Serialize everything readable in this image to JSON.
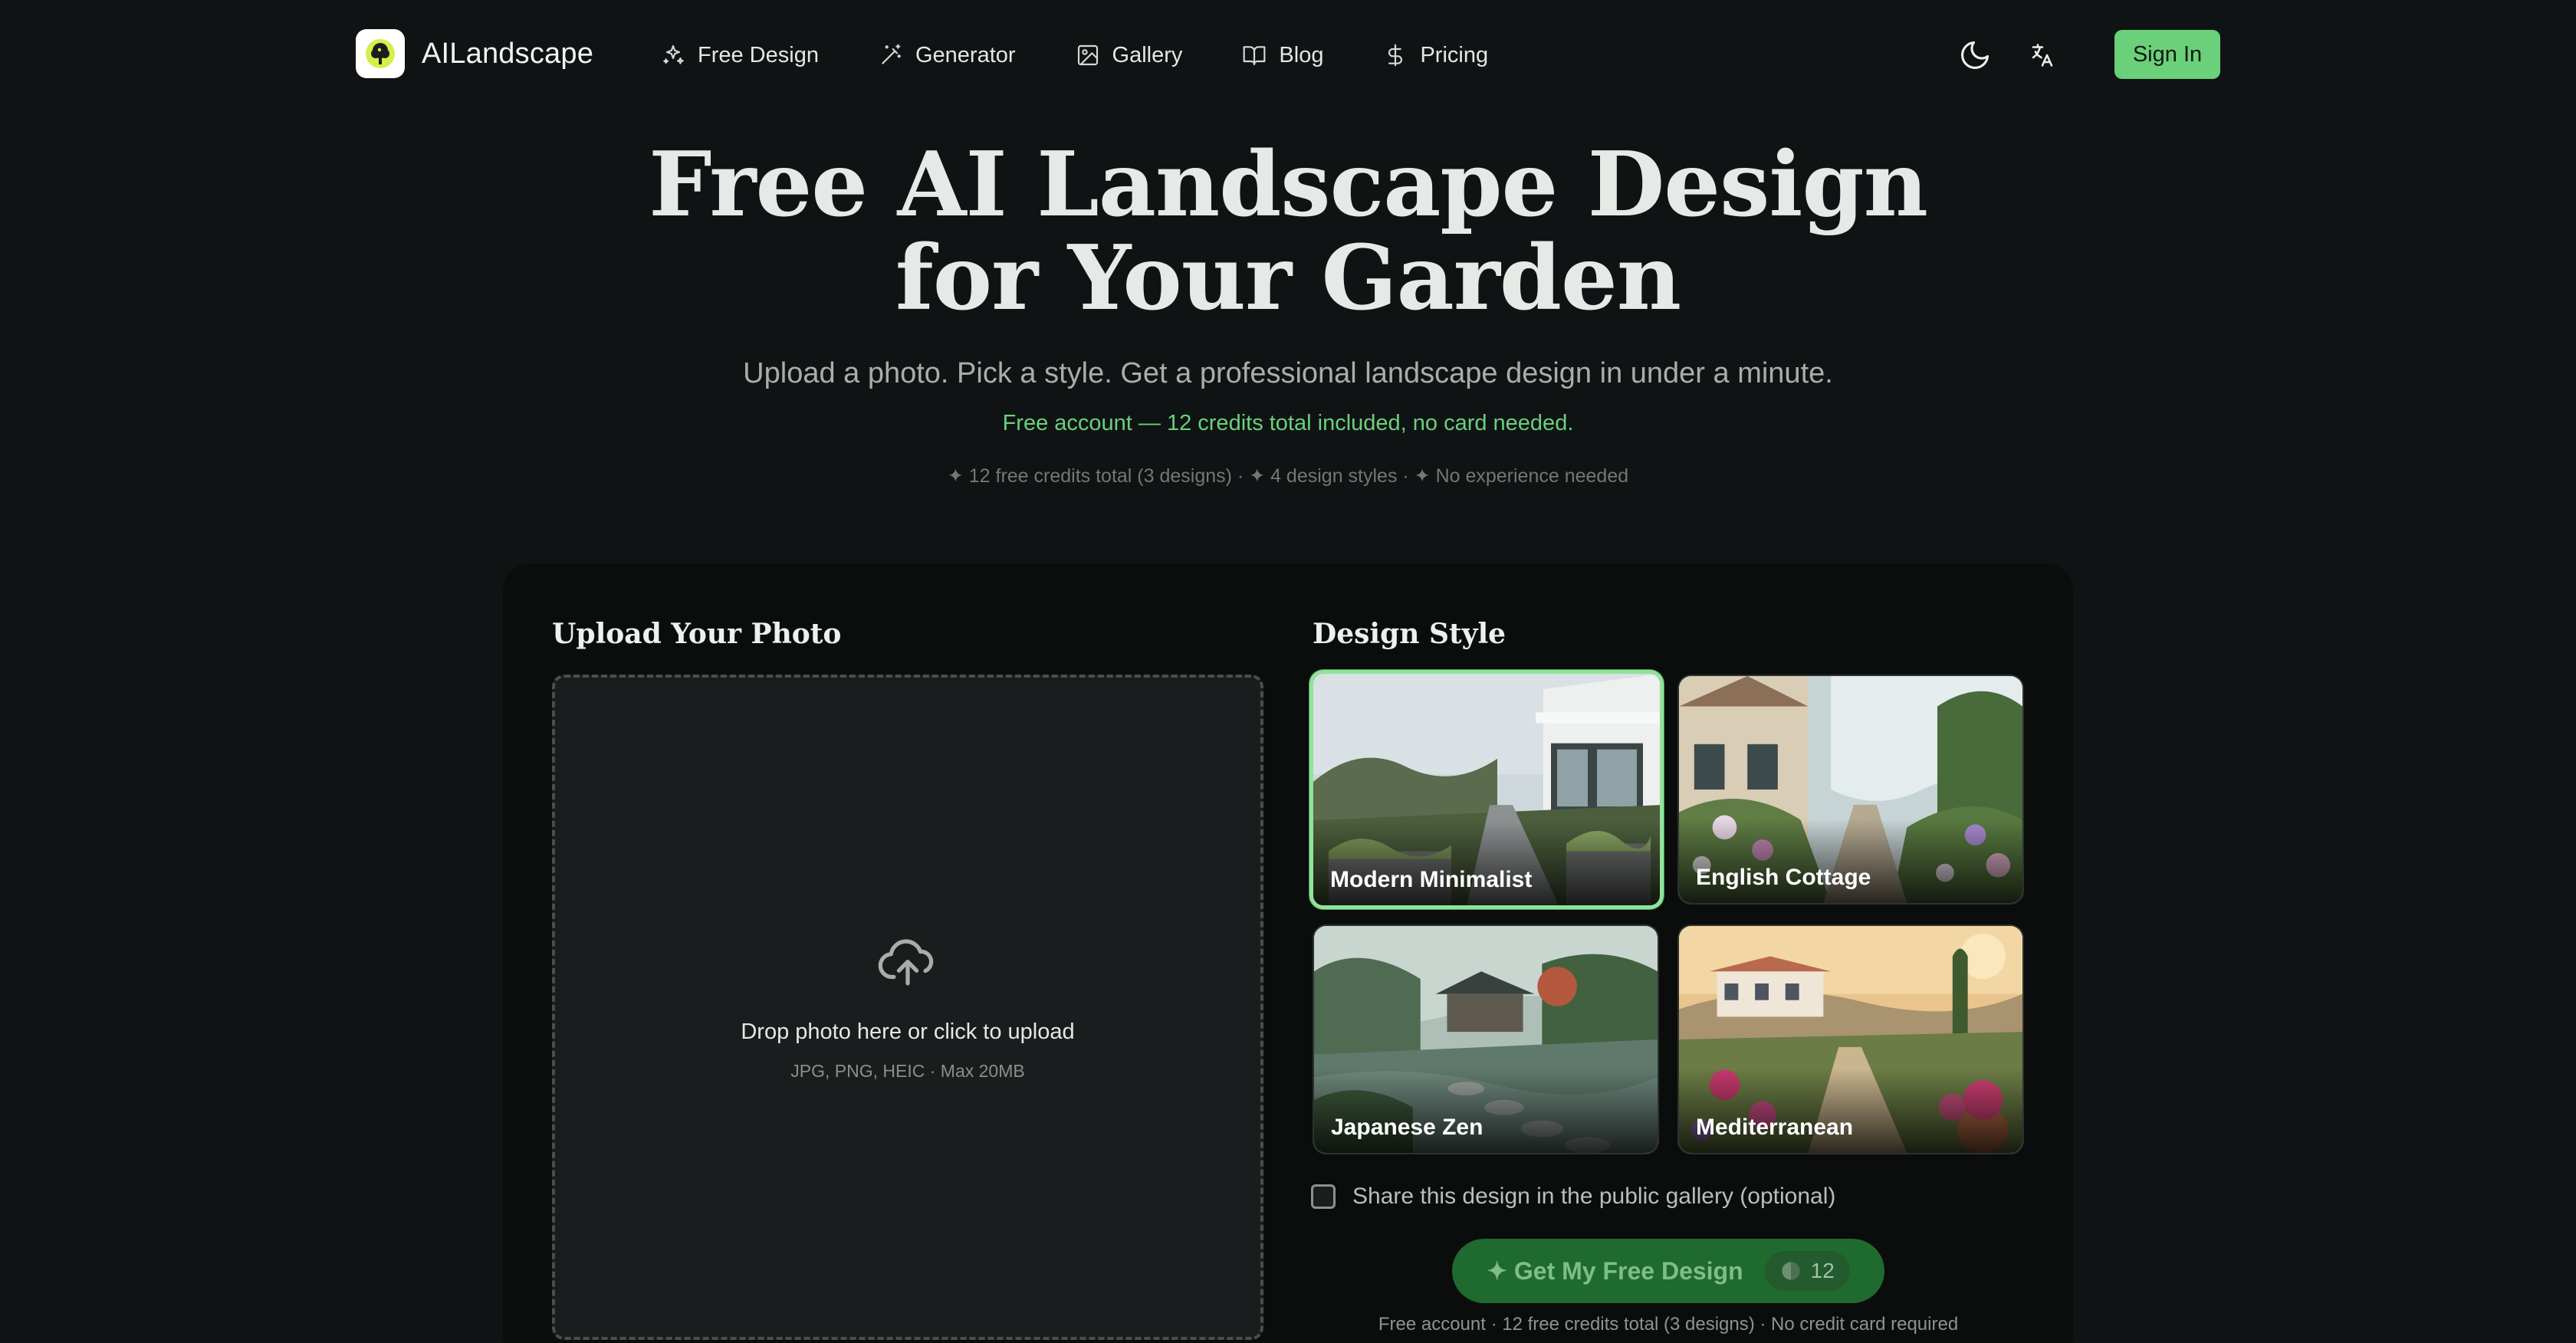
{
  "brand": {
    "name": "AILandscape"
  },
  "nav": {
    "items": [
      {
        "label": "Free Design",
        "icon": "sparkles-icon"
      },
      {
        "label": "Generator",
        "icon": "magic-wand-icon"
      },
      {
        "label": "Gallery",
        "icon": "image-icon"
      },
      {
        "label": "Blog",
        "icon": "book-open-icon"
      },
      {
        "label": "Pricing",
        "icon": "dollar-icon"
      }
    ]
  },
  "header": {
    "theme_icon": "moon-icon",
    "language_icon": "translate-icon",
    "signin_label": "Sign In"
  },
  "hero": {
    "title_line1": "Free AI Landscape Design",
    "title_line2": "for Your Garden",
    "subtitle": "Upload a photo. Pick a style. Get a professional landscape design in under a minute.",
    "free_note": "Free account — 12 credits total included, no card needed.",
    "features": "✦ 12 free credits total (3 designs) · ✦ 4 design styles · ✦ No experience needed"
  },
  "upload": {
    "title": "Upload Your Photo",
    "icon": "cloud-upload-icon",
    "main_text": "Drop photo here or click to upload",
    "hint": "JPG, PNG, HEIC · Max 20MB"
  },
  "styles": {
    "title": "Design Style",
    "selected": "Modern Minimalist",
    "items": [
      {
        "label": "Modern Minimalist"
      },
      {
        "label": "English Cottage"
      },
      {
        "label": "Japanese Zen"
      },
      {
        "label": "Mediterranean"
      }
    ]
  },
  "share": {
    "label": "Share this design in the public gallery (optional)",
    "checked": false
  },
  "cta": {
    "label": "✦ Get My Free Design",
    "credits": "12",
    "footnote": "Free account · 12 free credits total (3 designs) · No credit card required"
  },
  "colors": {
    "accent": "#6bd07a",
    "background": "#0f1314",
    "cta_background": "#1f6a2f"
  }
}
